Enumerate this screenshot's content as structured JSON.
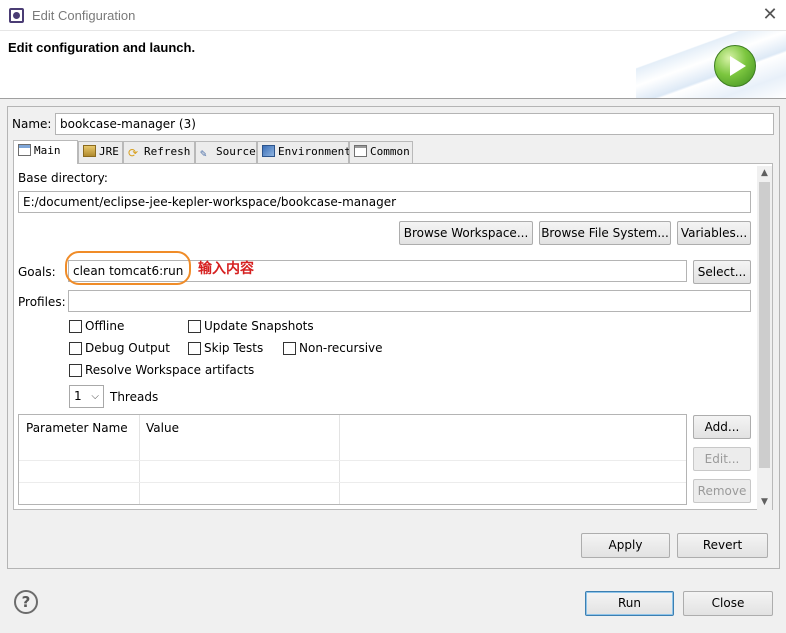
{
  "window": {
    "title": "Edit Configuration"
  },
  "header": {
    "title": "Edit configuration and launch."
  },
  "name": {
    "label": "Name:",
    "value": "bookcase-manager (3)"
  },
  "tabs": [
    {
      "label": "Main",
      "icon": "main-tab-icon"
    },
    {
      "label": "JRE",
      "icon": "jre-icon"
    },
    {
      "label": "Refresh",
      "icon": "refresh-icon"
    },
    {
      "label": "Source",
      "icon": "source-icon"
    },
    {
      "label": "Environment",
      "icon": "environment-icon"
    },
    {
      "label": "Common",
      "icon": "common-icon"
    }
  ],
  "main": {
    "base_dir_label": "Base directory:",
    "base_dir_value": "E:/document/eclipse-jee-kepler-workspace/bookcase-manager",
    "browse_workspace": "Browse Workspace...",
    "browse_fs": "Browse File System...",
    "variables": "Variables...",
    "goals_label": "Goals:",
    "goals_value": "clean tomcat6:run",
    "select": "Select...",
    "profiles_label": "Profiles:",
    "profiles_value": "",
    "checkboxes": {
      "offline": "Offline",
      "update_snapshots": "Update Snapshots",
      "debug_output": "Debug Output",
      "skip_tests": "Skip Tests",
      "non_recursive": "Non-recursive",
      "resolve_workspace": "Resolve Workspace artifacts"
    },
    "threads_value": "1",
    "threads_label": "Threads",
    "table": {
      "col_name": "Parameter Name",
      "col_value": "Value"
    },
    "add": "Add...",
    "edit": "Edit...",
    "remove": "Remove"
  },
  "annotation": "输入内容",
  "buttons": {
    "apply": "Apply",
    "revert": "Revert",
    "run": "Run",
    "close": "Close"
  },
  "help": "?"
}
